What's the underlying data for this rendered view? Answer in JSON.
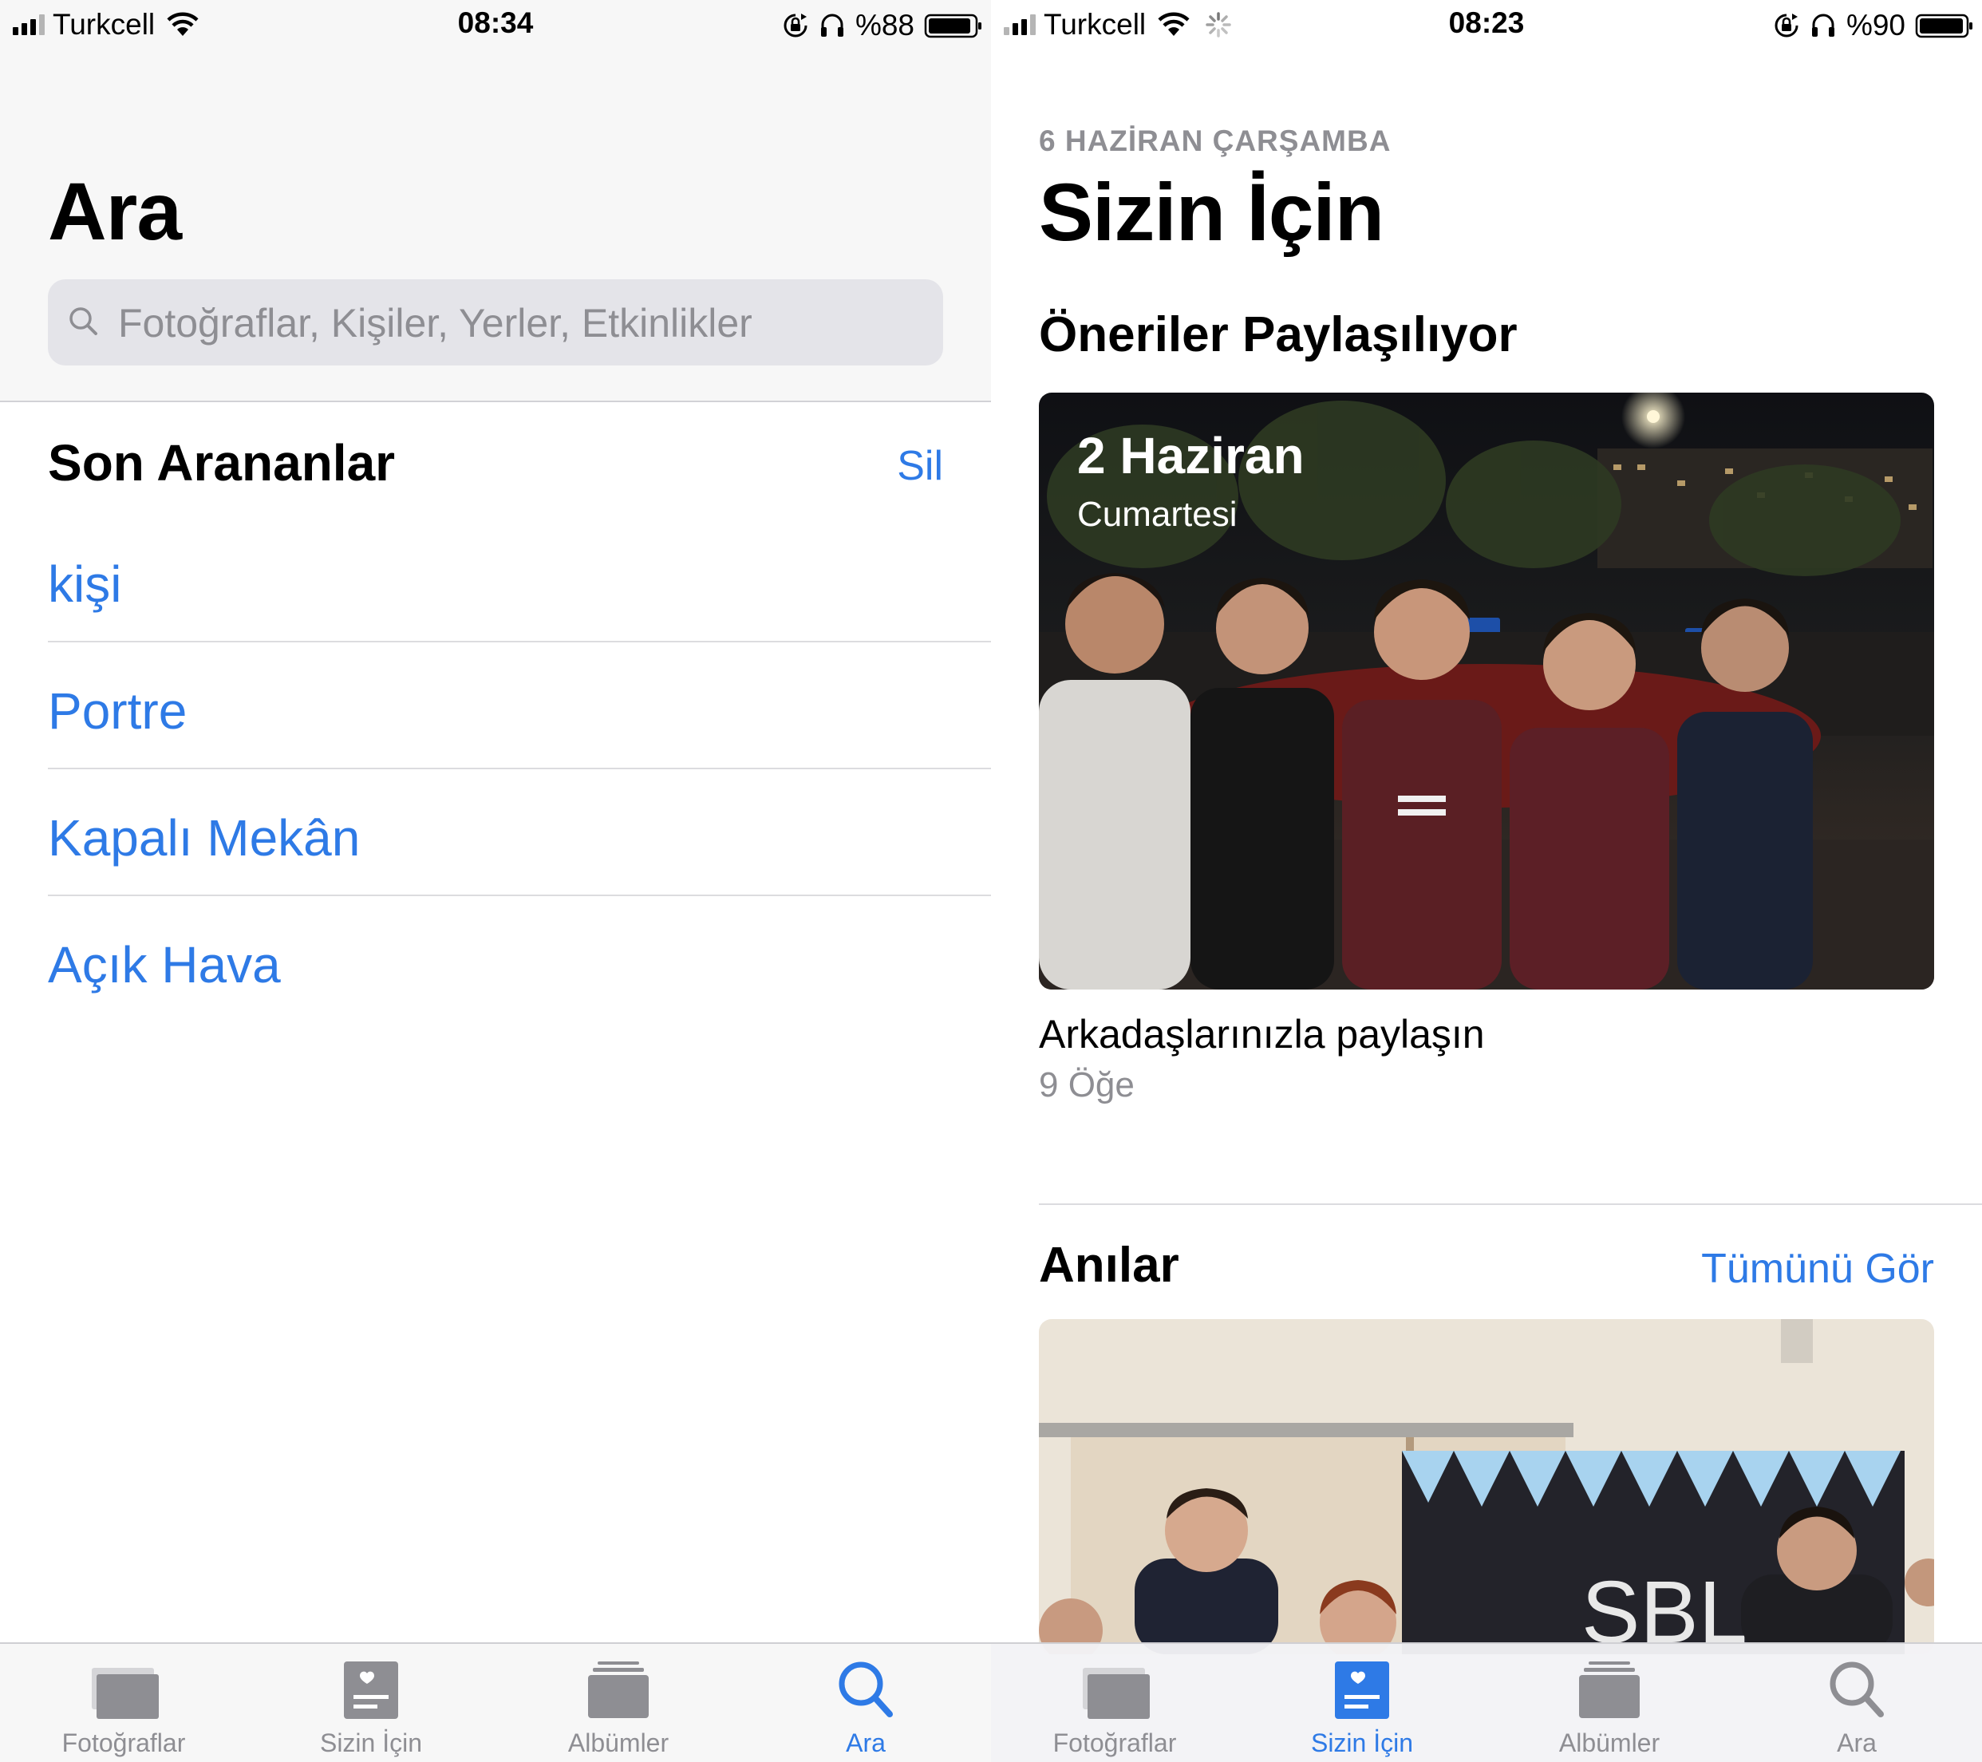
{
  "left": {
    "status": {
      "carrier": "Turkcell",
      "time": "08:34",
      "battery": "%88"
    },
    "title": "Ara",
    "search": {
      "placeholder": "Fotoğraflar, Kişiler, Yerler, Etkinlikler"
    },
    "recent": {
      "title": "Son Arananlar",
      "clear_label": "Sil",
      "items": [
        "kişi",
        "Portre",
        "Kapalı Mekân",
        "Açık Hava"
      ]
    },
    "tabs": [
      {
        "label": "Fotoğraflar",
        "icon": "photos-icon"
      },
      {
        "label": "Sizin İçin",
        "icon": "for-you-icon"
      },
      {
        "label": "Albümler",
        "icon": "albums-icon"
      },
      {
        "label": "Ara",
        "icon": "search-icon",
        "active": true
      }
    ]
  },
  "right": {
    "status": {
      "carrier": "Turkcell",
      "time": "08:23",
      "battery": "%90"
    },
    "date_caption": "6 HAZİRAN ÇARŞAMBA",
    "title": "Sizin İçin",
    "sharing": {
      "title": "Öneriler Paylaşılıyor",
      "card_title": "2 Haziran",
      "card_subtitle": "Cumartesi",
      "caption": "Arkadaşlarınızla paylaşın",
      "count": "9 Öğe"
    },
    "memories": {
      "title": "Anılar",
      "see_all_label": "Tümünü Gör",
      "banner_text": "SBL"
    },
    "tabs": [
      {
        "label": "Fotoğraflar",
        "icon": "photos-icon"
      },
      {
        "label": "Sizin İçin",
        "icon": "for-you-icon",
        "active": true
      },
      {
        "label": "Albümler",
        "icon": "albums-icon"
      },
      {
        "label": "Ara",
        "icon": "search-icon"
      }
    ]
  },
  "colors": {
    "accent": "#2e7ae6",
    "secondary_text": "#8e8e93"
  }
}
